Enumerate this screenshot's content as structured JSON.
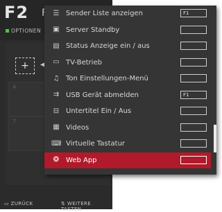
{
  "background": {
    "title": "F2",
    "title_suffix": "F",
    "options_label": "Optionen",
    "tile_numbers": [
      "4",
      "7"
    ],
    "add_symbol": "+",
    "footer_back": "Zurück",
    "footer_more": "Weitere Tasten"
  },
  "menu": {
    "items": [
      {
        "label": "Sender Liste anzeigen",
        "icon": "list-icon",
        "glyph": "☰",
        "key": "F1",
        "active": false
      },
      {
        "label": "Server Standby",
        "icon": "server-icon",
        "glyph": "▣",
        "key": "",
        "active": false
      },
      {
        "label": "Status Anzeige ein / aus",
        "icon": "status-display-icon",
        "glyph": "▤",
        "key": "",
        "active": false
      },
      {
        "label": "TV-Betrieb",
        "icon": "tv-icon",
        "glyph": "▭",
        "key": "",
        "active": false
      },
      {
        "label": "Ton Einstellungen-Menü",
        "icon": "music-note-icon",
        "glyph": "♫",
        "key": "",
        "active": false
      },
      {
        "label": "USB Gerät abmelden",
        "icon": "usb-icon",
        "glyph": "⇉",
        "key": "F1",
        "active": false
      },
      {
        "label": "Untertitel Ein / Aus",
        "icon": "subtitle-icon",
        "glyph": "⊟",
        "key": "",
        "active": false
      },
      {
        "label": "Videos",
        "icon": "film-icon",
        "glyph": "▦",
        "key": "",
        "active": false
      },
      {
        "label": "Virtuelle Tastatur",
        "icon": "keyboard-icon",
        "glyph": "⌨",
        "key": "",
        "active": false
      },
      {
        "label": "Web App",
        "icon": "web-app-icon",
        "glyph": "❂",
        "key": "",
        "active": true
      }
    ]
  },
  "colors": {
    "active_item": "#b11a2b",
    "menu_bg": "#353535",
    "options_dot": "#4cc34c"
  }
}
